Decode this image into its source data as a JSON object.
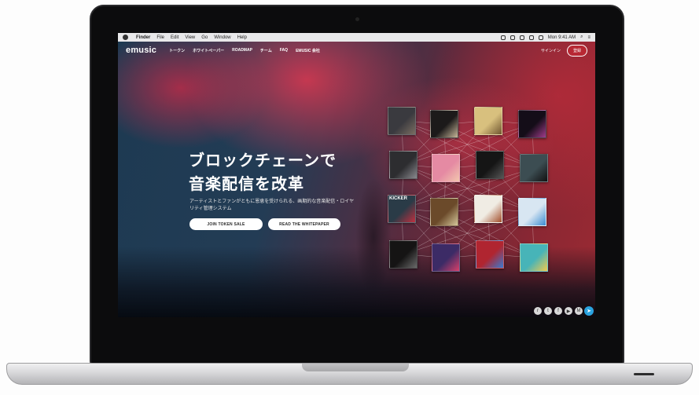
{
  "menubar": {
    "app": "Finder",
    "items": [
      "File",
      "Edit",
      "View",
      "Go",
      "Window",
      "Help"
    ],
    "clock": "Mon 9:41 AM"
  },
  "site": {
    "logo": "emusic",
    "nav": [
      "トークン",
      "ホワイトペーパー",
      "ROADMAP",
      "チーム",
      "FAQ",
      "EMUSIC 会社"
    ],
    "signin": "サインイン",
    "register": "登録"
  },
  "hero": {
    "title_line1": "ブロックチェーンで",
    "title_line2": "音楽配信を改革",
    "subtitle": "アーティストとファンがともに恩恵を受けられる、画期的な音楽配信・ロイヤリティ管理システム",
    "cta_primary": "JOIN TOKEN SALE",
    "cta_secondary": "READ THE WHITEPAPER"
  },
  "albums": [
    {
      "color": "#3a3a3f",
      "accent": "#7a6e62",
      "label": ""
    },
    {
      "color": "#1c1a1a",
      "accent": "#c8b79a",
      "label": ""
    },
    {
      "color": "#d8c07e",
      "accent": "#6f5530",
      "label": ""
    },
    {
      "color": "#140d18",
      "accent": "#a13c8c",
      "label": ""
    },
    {
      "color": "#2d2d30",
      "accent": "#8a8a8f",
      "label": ""
    },
    {
      "color": "#e58aa3",
      "accent": "#f2c7ae",
      "label": ""
    },
    {
      "color": "#151515",
      "accent": "#565656",
      "label": ""
    },
    {
      "color": "#3c4d52",
      "accent": "#111111",
      "label": ""
    },
    {
      "color": "#2a3b47",
      "accent": "#c03040",
      "label": "KICKER"
    },
    {
      "color": "#6b4a2a",
      "accent": "#d5c79a",
      "label": ""
    },
    {
      "color": "#f0ece4",
      "accent": "#a24d2a",
      "label": ""
    },
    {
      "color": "#d8e6f2",
      "accent": "#3a8bd1",
      "label": ""
    },
    {
      "color": "#151414",
      "accent": "#6a6a6a",
      "label": ""
    },
    {
      "color": "#3c2b66",
      "accent": "#d9406a",
      "label": ""
    },
    {
      "color": "#b02530",
      "accent": "#3a7bd0",
      "label": ""
    },
    {
      "color": "#47b4b8",
      "accent": "#f2c94c",
      "label": ""
    }
  ],
  "socials": [
    "reddit-icon",
    "twitter-icon",
    "facebook-icon",
    "youtube-icon",
    "medium-icon"
  ]
}
